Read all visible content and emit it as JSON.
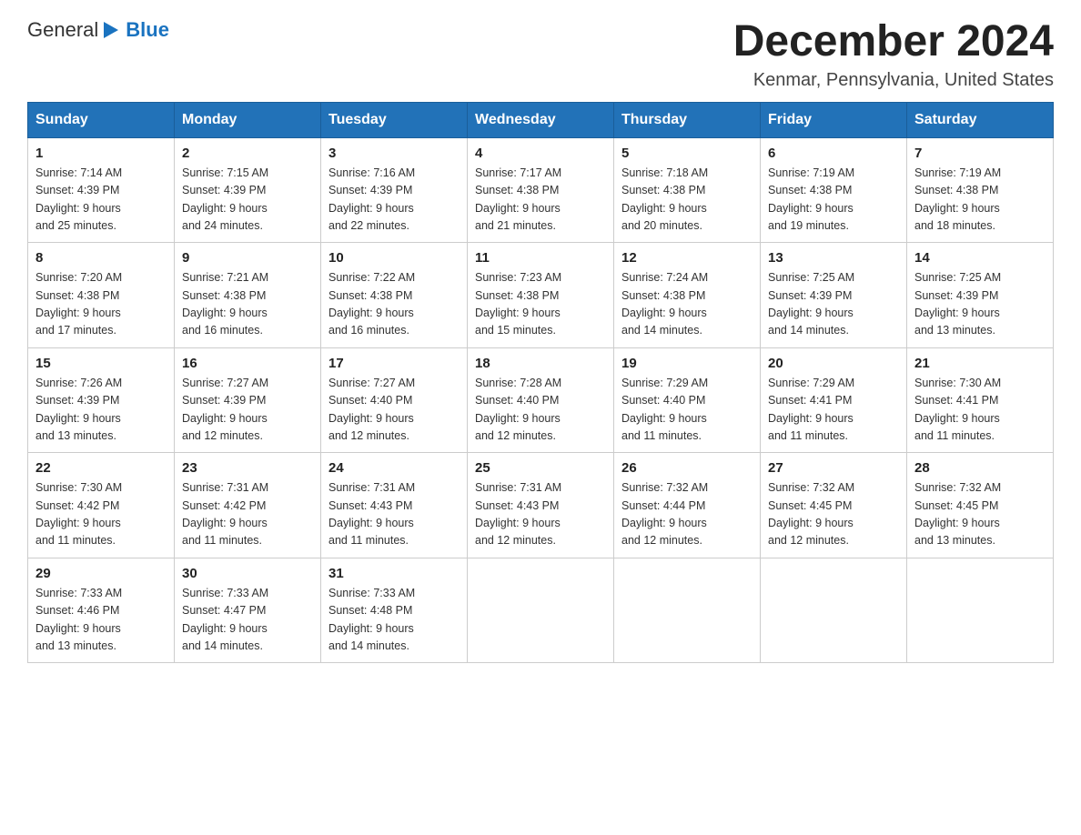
{
  "logo": {
    "text_general": "General",
    "text_blue": "Blue"
  },
  "header": {
    "title": "December 2024",
    "subtitle": "Kenmar, Pennsylvania, United States"
  },
  "weekdays": [
    "Sunday",
    "Monday",
    "Tuesday",
    "Wednesday",
    "Thursday",
    "Friday",
    "Saturday"
  ],
  "weeks": [
    [
      {
        "day": "1",
        "sunrise": "7:14 AM",
        "sunset": "4:39 PM",
        "daylight": "9 hours and 25 minutes."
      },
      {
        "day": "2",
        "sunrise": "7:15 AM",
        "sunset": "4:39 PM",
        "daylight": "9 hours and 24 minutes."
      },
      {
        "day": "3",
        "sunrise": "7:16 AM",
        "sunset": "4:39 PM",
        "daylight": "9 hours and 22 minutes."
      },
      {
        "day": "4",
        "sunrise": "7:17 AM",
        "sunset": "4:38 PM",
        "daylight": "9 hours and 21 minutes."
      },
      {
        "day": "5",
        "sunrise": "7:18 AM",
        "sunset": "4:38 PM",
        "daylight": "9 hours and 20 minutes."
      },
      {
        "day": "6",
        "sunrise": "7:19 AM",
        "sunset": "4:38 PM",
        "daylight": "9 hours and 19 minutes."
      },
      {
        "day": "7",
        "sunrise": "7:19 AM",
        "sunset": "4:38 PM",
        "daylight": "9 hours and 18 minutes."
      }
    ],
    [
      {
        "day": "8",
        "sunrise": "7:20 AM",
        "sunset": "4:38 PM",
        "daylight": "9 hours and 17 minutes."
      },
      {
        "day": "9",
        "sunrise": "7:21 AM",
        "sunset": "4:38 PM",
        "daylight": "9 hours and 16 minutes."
      },
      {
        "day": "10",
        "sunrise": "7:22 AM",
        "sunset": "4:38 PM",
        "daylight": "9 hours and 16 minutes."
      },
      {
        "day": "11",
        "sunrise": "7:23 AM",
        "sunset": "4:38 PM",
        "daylight": "9 hours and 15 minutes."
      },
      {
        "day": "12",
        "sunrise": "7:24 AM",
        "sunset": "4:38 PM",
        "daylight": "9 hours and 14 minutes."
      },
      {
        "day": "13",
        "sunrise": "7:25 AM",
        "sunset": "4:39 PM",
        "daylight": "9 hours and 14 minutes."
      },
      {
        "day": "14",
        "sunrise": "7:25 AM",
        "sunset": "4:39 PM",
        "daylight": "9 hours and 13 minutes."
      }
    ],
    [
      {
        "day": "15",
        "sunrise": "7:26 AM",
        "sunset": "4:39 PM",
        "daylight": "9 hours and 13 minutes."
      },
      {
        "day": "16",
        "sunrise": "7:27 AM",
        "sunset": "4:39 PM",
        "daylight": "9 hours and 12 minutes."
      },
      {
        "day": "17",
        "sunrise": "7:27 AM",
        "sunset": "4:40 PM",
        "daylight": "9 hours and 12 minutes."
      },
      {
        "day": "18",
        "sunrise": "7:28 AM",
        "sunset": "4:40 PM",
        "daylight": "9 hours and 12 minutes."
      },
      {
        "day": "19",
        "sunrise": "7:29 AM",
        "sunset": "4:40 PM",
        "daylight": "9 hours and 11 minutes."
      },
      {
        "day": "20",
        "sunrise": "7:29 AM",
        "sunset": "4:41 PM",
        "daylight": "9 hours and 11 minutes."
      },
      {
        "day": "21",
        "sunrise": "7:30 AM",
        "sunset": "4:41 PM",
        "daylight": "9 hours and 11 minutes."
      }
    ],
    [
      {
        "day": "22",
        "sunrise": "7:30 AM",
        "sunset": "4:42 PM",
        "daylight": "9 hours and 11 minutes."
      },
      {
        "day": "23",
        "sunrise": "7:31 AM",
        "sunset": "4:42 PM",
        "daylight": "9 hours and 11 minutes."
      },
      {
        "day": "24",
        "sunrise": "7:31 AM",
        "sunset": "4:43 PM",
        "daylight": "9 hours and 11 minutes."
      },
      {
        "day": "25",
        "sunrise": "7:31 AM",
        "sunset": "4:43 PM",
        "daylight": "9 hours and 12 minutes."
      },
      {
        "day": "26",
        "sunrise": "7:32 AM",
        "sunset": "4:44 PM",
        "daylight": "9 hours and 12 minutes."
      },
      {
        "day": "27",
        "sunrise": "7:32 AM",
        "sunset": "4:45 PM",
        "daylight": "9 hours and 12 minutes."
      },
      {
        "day": "28",
        "sunrise": "7:32 AM",
        "sunset": "4:45 PM",
        "daylight": "9 hours and 13 minutes."
      }
    ],
    [
      {
        "day": "29",
        "sunrise": "7:33 AM",
        "sunset": "4:46 PM",
        "daylight": "9 hours and 13 minutes."
      },
      {
        "day": "30",
        "sunrise": "7:33 AM",
        "sunset": "4:47 PM",
        "daylight": "9 hours and 14 minutes."
      },
      {
        "day": "31",
        "sunrise": "7:33 AM",
        "sunset": "4:48 PM",
        "daylight": "9 hours and 14 minutes."
      },
      null,
      null,
      null,
      null
    ]
  ],
  "labels": {
    "sunrise": "Sunrise:",
    "sunset": "Sunset:",
    "daylight": "Daylight:"
  }
}
